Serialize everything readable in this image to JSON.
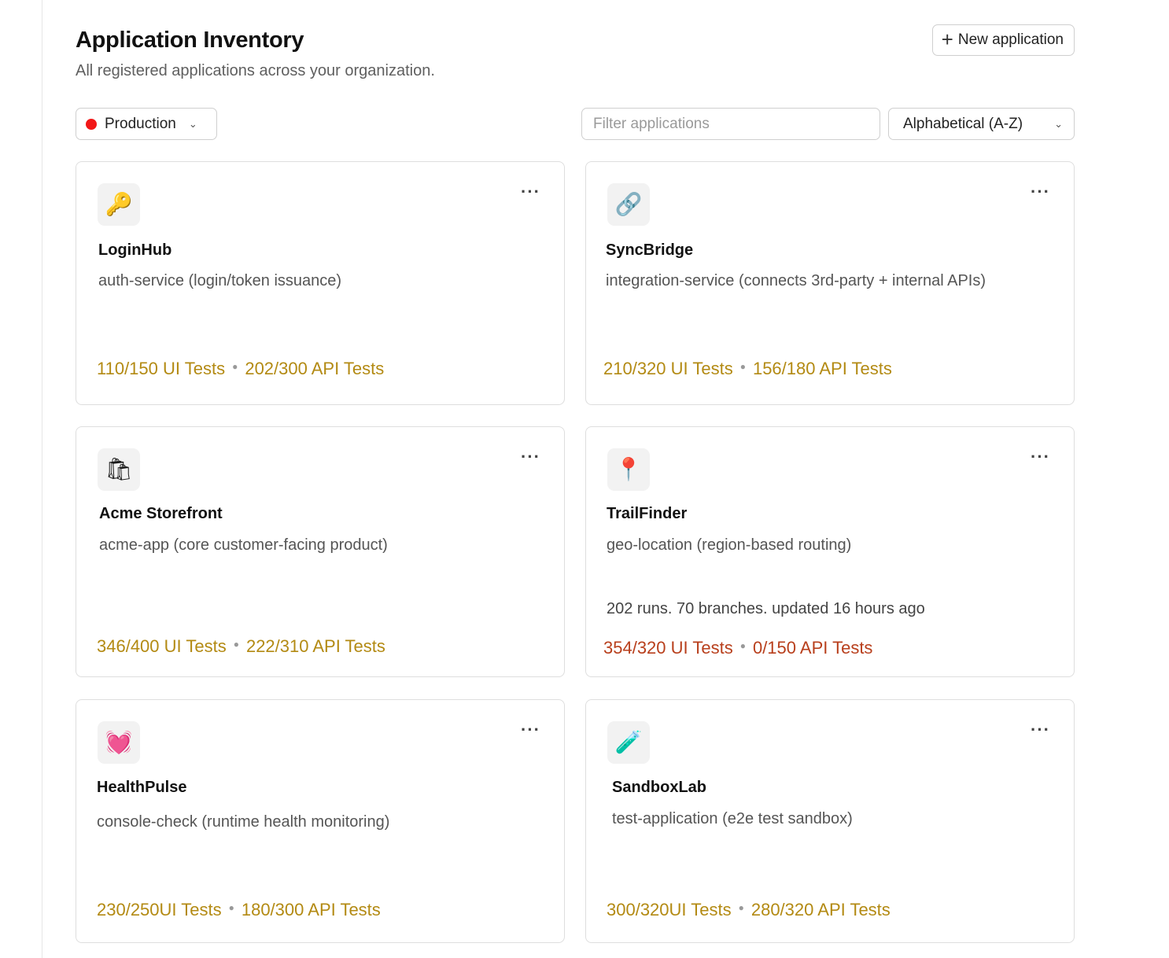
{
  "header": {
    "title": "Application Inventory",
    "subtitle": "All registered applications across your organization.",
    "new_button_label": "New application",
    "new_button_icon": "plus-icon"
  },
  "toolbar": {
    "environment": {
      "label": "Production",
      "dot_color": "#f21818",
      "icon": "chevron-down-icon"
    },
    "filter": {
      "placeholder": "Filter applications",
      "value": ""
    },
    "sort": {
      "label": "Alphabetical (A-Z)",
      "icon": "chevron-down-icon"
    }
  },
  "colors": {
    "healthy": "#b38a13",
    "failing": "#b83f1c",
    "env_dot": "#f21818"
  },
  "apps": [
    {
      "name": "LoginHub",
      "icon": "🔑",
      "icon_name": "key-icon",
      "description": "auth-service (login/token issuance)",
      "meta": "",
      "ui_tests": "110/150 UI Tests",
      "api_tests": "202/300 API Tests",
      "status": "ok"
    },
    {
      "name": "SyncBridge",
      "icon": "🔗",
      "icon_name": "link-icon",
      "description": "integration-service (connects 3rd-party + internal APIs)",
      "meta": "",
      "ui_tests": "210/320 UI Tests",
      "api_tests": "156/180 API Tests",
      "status": "ok"
    },
    {
      "name": "Acme Storefront",
      "icon": "🛍",
      "icon_name": "shopping-bags-icon",
      "description": "acme-app (core customer-facing product)",
      "meta": "",
      "ui_tests": "346/400 UI Tests",
      "api_tests": "222/310 API Tests",
      "status": "ok"
    },
    {
      "name": "TrailFinder",
      "icon": "📍",
      "icon_name": "pushpin-icon",
      "description": "geo-location (region-based routing)",
      "meta": "202 runs. 70 branches. updated 16 hours ago",
      "ui_tests": "354/320 UI Tests",
      "api_tests": "0/150 API Tests",
      "status": "bad"
    },
    {
      "name": "HealthPulse",
      "icon": "💓",
      "icon_name": "beating-heart-icon",
      "description": "console-check (runtime health monitoring)",
      "meta": "",
      "ui_tests": "230/250UI Tests",
      "api_tests": "180/300 API Tests",
      "status": "ok"
    },
    {
      "name": "SandboxLab",
      "icon": "🧪",
      "icon_name": "test-tube-icon",
      "description": "test-application (e2e test sandbox)",
      "meta": "",
      "ui_tests": "300/320UI Tests",
      "api_tests": "280/320 API Tests",
      "status": "ok"
    }
  ]
}
